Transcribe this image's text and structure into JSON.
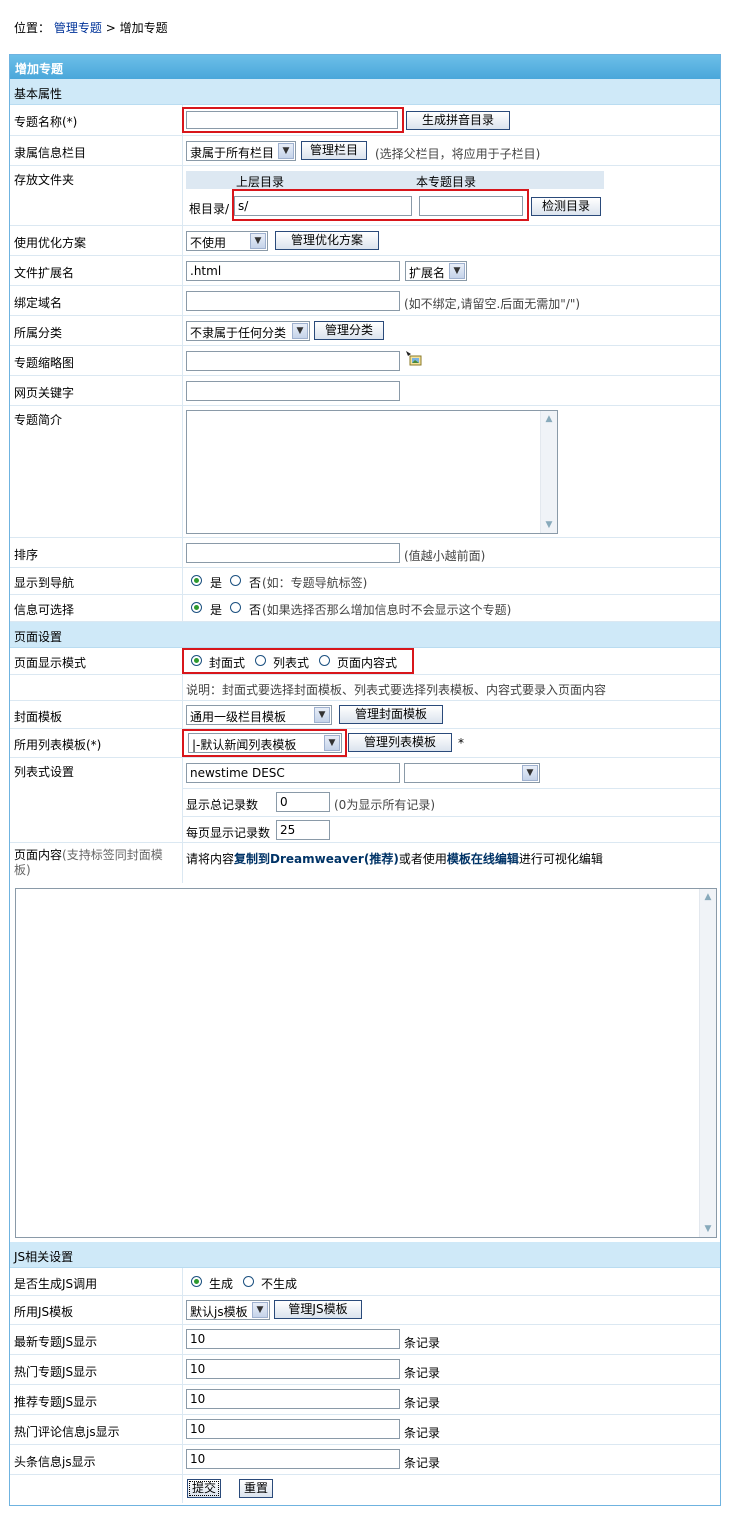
{
  "breadcrumb": {
    "prefix": "位置：",
    "link1": "管理专题",
    "sep": " > ",
    "current": "增加专题"
  },
  "form_title": "增加专题",
  "sections": {
    "basic": "基本属性",
    "page": "页面设置",
    "js": "JS相关设置"
  },
  "fields": {
    "name": {
      "label": "专题名称(*)",
      "value": "",
      "button": "生成拼音目录"
    },
    "parent": {
      "label": "隶属信息栏目",
      "select": "隶属于所有栏目",
      "button": "管理栏目",
      "note": "(选择父栏目，将应用于子栏目)"
    },
    "folder": {
      "label": "存放文件夹",
      "col1": "上层目录",
      "col2": "本专题目录",
      "root": "根目录/",
      "upper_value": "s/",
      "own_value": "",
      "button": "检测目录"
    },
    "optimize": {
      "label": "使用优化方案",
      "select": "不使用",
      "button": "管理优化方案"
    },
    "ext": {
      "label": "文件扩展名",
      "value": ".html",
      "select": "扩展名"
    },
    "domain": {
      "label": "绑定域名",
      "value": "",
      "note": "(如不绑定,请留空.后面无需加\"/\")"
    },
    "category": {
      "label": "所属分类",
      "select": "不隶属于任何分类",
      "button": "管理分类"
    },
    "thumb": {
      "label": "专题缩略图",
      "value": ""
    },
    "keywords": {
      "label": "网页关键字",
      "value": ""
    },
    "intro": {
      "label": "专题简介",
      "value": ""
    },
    "order": {
      "label": "排序",
      "value": "",
      "note": "(值越小越前面)"
    },
    "nav": {
      "label": "显示到导航",
      "yes": "是",
      "no": "否",
      "note": "(如：专题导航标签)",
      "selected": "yes"
    },
    "selectable": {
      "label": "信息可选择",
      "yes": "是",
      "no": "否",
      "note": "(如果选择否那么增加信息时不会显示这个专题)",
      "selected": "yes"
    },
    "display_mode": {
      "label": "页面显示模式",
      "opt1": "封面式",
      "opt2": "列表式",
      "opt3": "页面内容式",
      "selected": "opt1",
      "note": "说明：封面式要选择封面模板、列表式要选择列表模板、内容式要录入页面内容"
    },
    "cover_tpl": {
      "label": "封面模板",
      "select": "通用一级栏目模板",
      "button": "管理封面模板"
    },
    "list_tpl": {
      "label": "所用列表模板(*)",
      "select": "|-默认新闻列表模板",
      "button": "管理列表模板",
      "star": "*"
    },
    "list_settings": {
      "label": "列表式设置",
      "sort_value": "newstime DESC",
      "sort_select": "",
      "total_label": "显示总记录数",
      "total_value": "0",
      "total_note": "(0为显示所有记录)",
      "perpage_label": "每页显示记录数",
      "perpage_value": "25"
    },
    "page_content": {
      "label": "页面内容",
      "label_note": "(支持标签同封面模板)",
      "hint_pre": "请将内容",
      "hint_link1": "复制到Dreamweaver(推荐)",
      "hint_mid": "或者使用",
      "hint_link2": "模板在线编辑",
      "hint_post": "进行可视化编辑"
    },
    "gen_js": {
      "label": "是否生成JS调用",
      "yes": "生成",
      "no": "不生成",
      "selected": "yes"
    },
    "js_tpl": {
      "label": "所用JS模板",
      "select": "默认js模板",
      "button": "管理JS模板"
    },
    "js_latest": {
      "label": "最新专题JS显示",
      "value": "10",
      "unit": "条记录"
    },
    "js_hot": {
      "label": "热门专题JS显示",
      "value": "10",
      "unit": "条记录"
    },
    "js_recommend": {
      "label": "推荐专题JS显示",
      "value": "10",
      "unit": "条记录"
    },
    "js_comment": {
      "label": "热门评论信息js显示",
      "value": "10",
      "unit": "条记录"
    },
    "js_headline": {
      "label": "头条信息js显示",
      "value": "10",
      "unit": "条记录"
    }
  },
  "buttons": {
    "submit": "提交",
    "reset": "重置"
  },
  "colors": {
    "header": "#4aa7da",
    "section": "#cfe9f8",
    "highlight": "#d8161b",
    "link": "#003399"
  }
}
